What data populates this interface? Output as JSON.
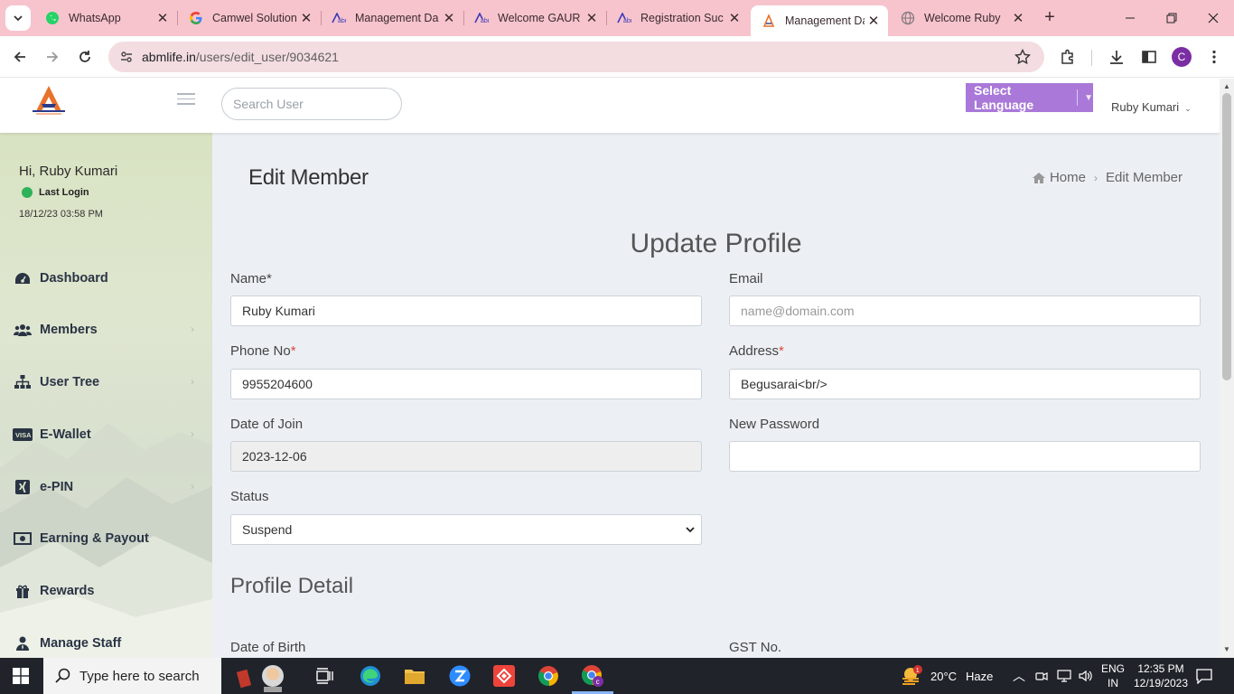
{
  "browser": {
    "tabs": [
      {
        "title": "WhatsApp",
        "icon": "whatsapp-icon"
      },
      {
        "title": "Camwel Solution",
        "icon": "google-icon"
      },
      {
        "title": "Management Da",
        "icon": "abm-icon"
      },
      {
        "title": "Welcome GAUR",
        "icon": "abm-icon"
      },
      {
        "title": "Registration Suc",
        "icon": "abm-icon"
      },
      {
        "title": "Management Da",
        "icon": "abm-logo-icon"
      },
      {
        "title": "Welcome Ruby",
        "icon": "globe-icon"
      }
    ],
    "url_domain": "abmlife.in",
    "url_path": "/users/edit_user/9034621",
    "profile_initial": "C"
  },
  "header": {
    "search_placeholder": "Search User",
    "language_label": "Select Language",
    "user_name": "Ruby Kumari"
  },
  "sidebar": {
    "greeting": "Hi, Ruby Kumari",
    "last_login_label": "Last Login",
    "last_login_time": "18/12/23 03:58 PM",
    "items": [
      {
        "label": "Dashboard",
        "icon": "dashboard-icon"
      },
      {
        "label": "Members",
        "icon": "users-icon"
      },
      {
        "label": "User Tree",
        "icon": "sitemap-icon"
      },
      {
        "label": "E-Wallet",
        "icon": "visa-icon"
      },
      {
        "label": "e-PIN",
        "icon": "xing-icon"
      },
      {
        "label": "Earning & Payout",
        "icon": "money-icon"
      },
      {
        "label": "Rewards",
        "icon": "gift-icon"
      },
      {
        "label": "Manage Staff",
        "icon": "user-tie-icon"
      }
    ]
  },
  "content": {
    "page_title": "Edit Member",
    "breadcrumb_home": "Home",
    "breadcrumb_current": "Edit Member",
    "section_title": "Update Profile",
    "profile_detail_title": "Profile Detail",
    "fields": {
      "name": {
        "label": "Name*",
        "value": "Ruby Kumari"
      },
      "email": {
        "label": "Email",
        "placeholder": "name@domain.com",
        "value": ""
      },
      "phone": {
        "label": "Phone No",
        "value": "9955204600"
      },
      "address": {
        "label": "Address",
        "value": "Begusarai<br/>"
      },
      "date_of_join": {
        "label": "Date of Join",
        "value": "2023-12-06"
      },
      "new_password": {
        "label": "New Password",
        "value": ""
      },
      "status": {
        "label": "Status",
        "value": "Suspend"
      },
      "date_of_birth": {
        "label": "Date of Birth"
      },
      "gst_no": {
        "label": "GST No."
      }
    }
  },
  "taskbar": {
    "search_placeholder": "Type here to search",
    "weather_temp": "20°C",
    "weather_cond": "Haze",
    "weather_badge": "1",
    "lang_top": "ENG",
    "lang_bottom": "IN",
    "time": "12:35 PM",
    "date": "12/19/2023"
  },
  "colors": {
    "tabbar": "#f7c4ce",
    "language_button": "#a978d8",
    "content_bg": "#ecf0f5",
    "required": "#dd4b39",
    "online_dot": "#2fb15a"
  }
}
